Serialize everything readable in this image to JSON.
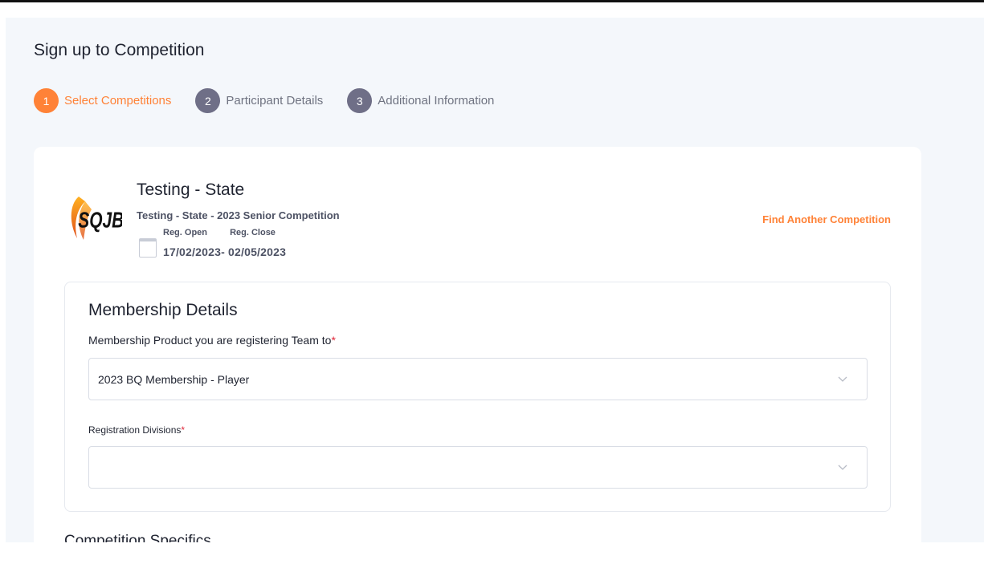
{
  "page": {
    "title": "Sign up to Competition"
  },
  "steps": [
    {
      "num": "1",
      "label": "Select Competitions",
      "active": true
    },
    {
      "num": "2",
      "label": "Participant Details",
      "active": false
    },
    {
      "num": "3",
      "label": "Additional Information",
      "active": false
    }
  ],
  "competition": {
    "logo_text": "SQJBC",
    "title": "Testing - State",
    "subtitle": "Testing - State - 2023 Senior Competition",
    "reg_open_label": "Reg. Open",
    "reg_close_label": "Reg. Close",
    "reg_dates": "17/02/2023- 02/05/2023",
    "find_another": "Find Another Competition"
  },
  "membership": {
    "title": "Membership Details",
    "product_label": "Membership Product you are registering Team to",
    "product_value": "2023 BQ Membership - Player",
    "divisions_label": "Registration Divisions",
    "divisions_value": "",
    "required_mark": "*"
  },
  "next_section": {
    "title": "Competition Specifics"
  },
  "colors": {
    "accent": "#ff8237",
    "step_inactive": "#6f6f87",
    "required": "#e0283a"
  }
}
